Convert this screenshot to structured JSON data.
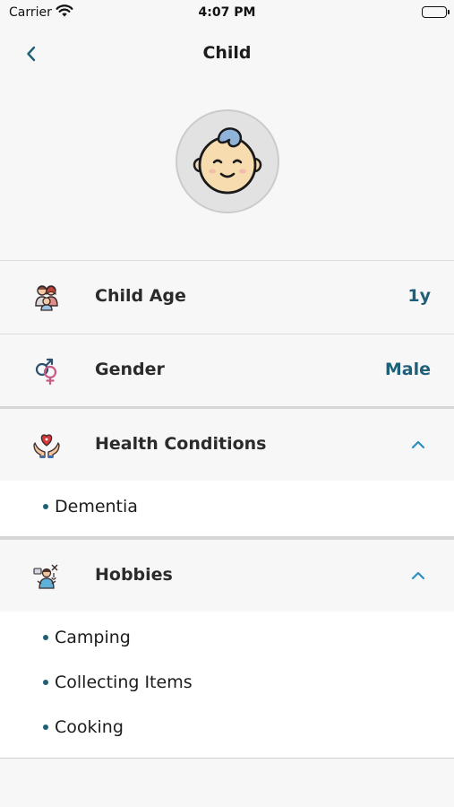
{
  "status_bar": {
    "carrier": "Carrier",
    "time": "4:07 PM",
    "icons": [
      "wifi-icon",
      "battery-icon"
    ]
  },
  "nav": {
    "title": "Child",
    "back_icon": "chevron-left-icon"
  },
  "profile": {
    "avatar_icon": "baby-face-icon"
  },
  "rows": {
    "age": {
      "label": "Child Age",
      "value": "1y",
      "icon": "family-icon"
    },
    "gender": {
      "label": "Gender",
      "value": "Male",
      "icon": "gender-symbols-icon"
    },
    "health": {
      "label": "Health Conditions",
      "icon": "heart-hands-icon",
      "expanded": true,
      "items": [
        "Dementia"
      ]
    },
    "hobbies": {
      "label": "Hobbies",
      "icon": "hobbies-person-icon",
      "expanded": true,
      "items": [
        "Camping",
        "Collecting Items",
        "Cooking"
      ]
    }
  },
  "colors": {
    "accent": "#1f5f78",
    "chevron": "#2e8fc0",
    "background": "#f7f7f7"
  }
}
